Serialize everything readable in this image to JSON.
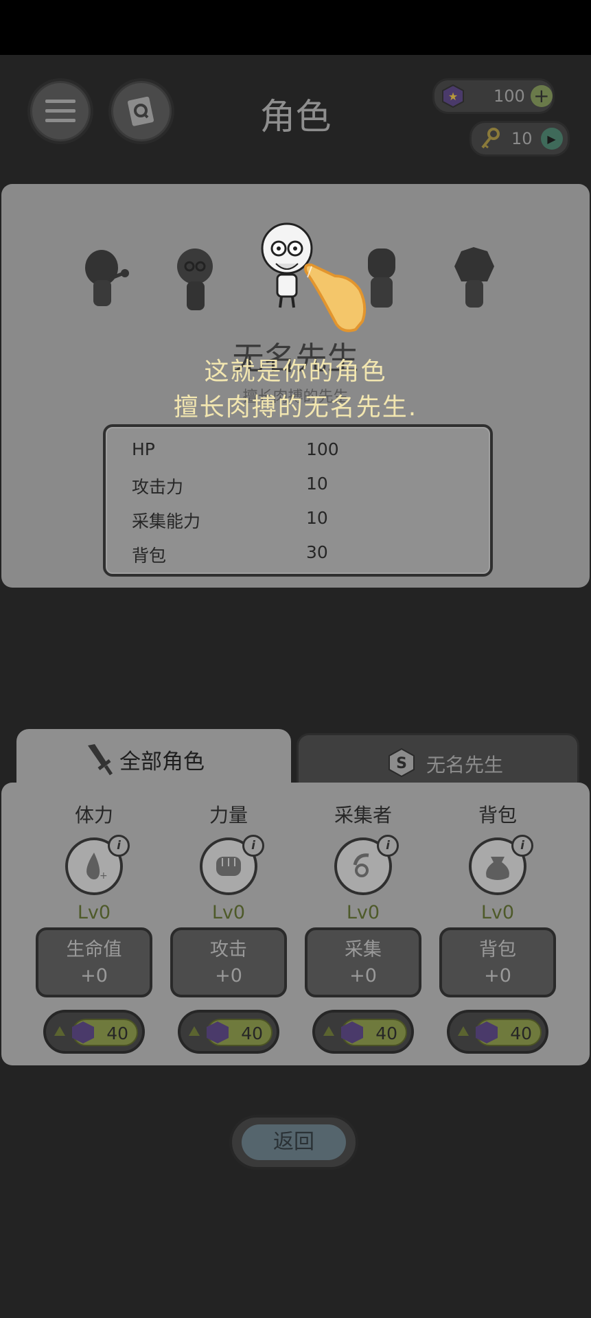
{
  "header": {
    "title": "角色",
    "gems": "100",
    "keys": "10"
  },
  "character": {
    "name": "无名先生",
    "subtitle": "擅长肉搏的先生",
    "stats": [
      {
        "label": "HP",
        "value": "100"
      },
      {
        "label": "攻击力",
        "value": "10"
      },
      {
        "label": "采集能力",
        "value": "10"
      },
      {
        "label": "背包",
        "value": "30"
      }
    ]
  },
  "tutorial": {
    "line1": "这就是你的角色",
    "line2": "擅长肉搏的无名先生."
  },
  "tabs": {
    "all_characters": "全部角色",
    "current": "无名先生"
  },
  "upgrades": [
    {
      "label": "体力",
      "level": "Lv0",
      "button_line1": "生命值",
      "button_line2": "+0",
      "cost": "40",
      "icon": "water-drop-icon"
    },
    {
      "label": "力量",
      "level": "Lv0",
      "button_line1": "攻击",
      "button_line2": "+0",
      "cost": "40",
      "icon": "fist-icon"
    },
    {
      "label": "采集者",
      "level": "Lv0",
      "button_line1": "采集",
      "button_line2": "+0",
      "cost": "40",
      "icon": "gather-hand-icon"
    },
    {
      "label": "背包",
      "level": "Lv0",
      "button_line1": "背包",
      "button_line2": "+0",
      "cost": "40",
      "icon": "sack-icon"
    }
  ],
  "info_badge": "i",
  "back_label": "返回",
  "colors": {
    "background": "#232323",
    "panel": "#8f8f8f",
    "tooltip_text": "#f2e6b0",
    "level_text": "#4e5a2a",
    "cost_green": "#6f7a3d"
  }
}
